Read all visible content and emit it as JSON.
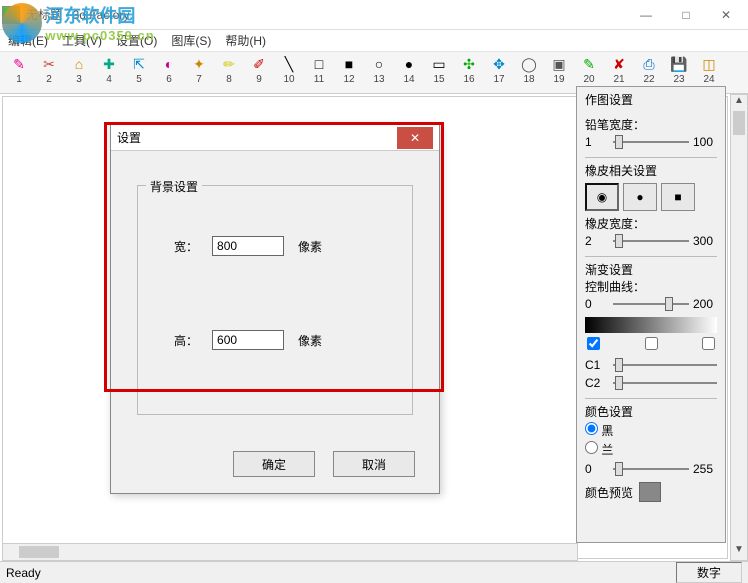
{
  "window": {
    "title": "无标题 - 3d Factory"
  },
  "menu": [
    "编辑(E)",
    "工具(V)",
    "设置(O)",
    "图库(S)",
    "帮助(H)"
  ],
  "toolbar": [
    {
      "n": "1",
      "icon": "✎",
      "c": "#e08"
    },
    {
      "n": "2",
      "icon": "✂",
      "c": "#c44"
    },
    {
      "n": "3",
      "icon": "⌂",
      "c": "#c80"
    },
    {
      "n": "4",
      "icon": "✚",
      "c": "#0a8"
    },
    {
      "n": "5",
      "icon": "⇱",
      "c": "#08c"
    },
    {
      "n": "6",
      "icon": "◐",
      "c": "#c08"
    },
    {
      "n": "7",
      "icon": "✦",
      "c": "#c80"
    },
    {
      "n": "8",
      "icon": "✏",
      "c": "#cc0"
    },
    {
      "n": "9",
      "icon": "✐",
      "c": "#c00"
    },
    {
      "n": "10",
      "icon": "╲",
      "c": "#000"
    },
    {
      "n": "11",
      "icon": "□",
      "c": "#000"
    },
    {
      "n": "12",
      "icon": "■",
      "c": "#000"
    },
    {
      "n": "13",
      "icon": "○",
      "c": "#000"
    },
    {
      "n": "14",
      "icon": "●",
      "c": "#000"
    },
    {
      "n": "15",
      "icon": "▭",
      "c": "#000"
    },
    {
      "n": "16",
      "icon": "✣",
      "c": "#0a0"
    },
    {
      "n": "17",
      "icon": "✥",
      "c": "#08c"
    },
    {
      "n": "18",
      "icon": "◯",
      "c": "#555"
    },
    {
      "n": "19",
      "icon": "▣",
      "c": "#555"
    },
    {
      "n": "20",
      "icon": "✎",
      "c": "#0a0"
    },
    {
      "n": "21",
      "icon": "✘",
      "c": "#c00"
    },
    {
      "n": "22",
      "icon": "⎙",
      "c": "#06c"
    },
    {
      "n": "23",
      "icon": "💾",
      "c": "#06c"
    },
    {
      "n": "24",
      "icon": "◫",
      "c": "#c80"
    }
  ],
  "dialog": {
    "title": "设置",
    "group_title": "背景设置",
    "width_label": "宽：",
    "width_value": "800",
    "height_label": "高：",
    "height_value": "600",
    "unit": "像素",
    "ok": "确定",
    "cancel": "取消"
  },
  "panel": {
    "title": "作图设置",
    "pencil_label": "铅笔宽度：",
    "pencil_min": "1",
    "pencil_max": "100",
    "eraser_section": "橡皮相关设置",
    "eraser_label": "橡皮宽度：",
    "eraser_min": "2",
    "eraser_max": "300",
    "gradient_section": "渐变设置",
    "curve_label": "控制曲线：",
    "grad_min": "0",
    "grad_max": "200",
    "c1": "C1",
    "c2": "C2",
    "color_section": "颜色设置",
    "black": "黑",
    "blue": "兰",
    "color_min": "0",
    "color_max": "255",
    "preview_label": "颜色预览"
  },
  "status": {
    "left": "Ready",
    "right": "数字"
  },
  "watermark": {
    "line1": "河东软件园",
    "line2": "www.pc0359.cn"
  }
}
